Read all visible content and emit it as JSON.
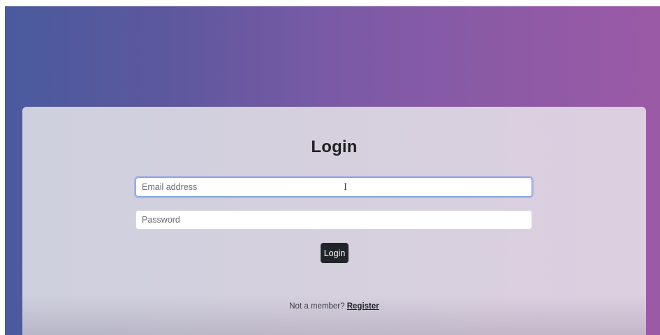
{
  "login_card": {
    "title": "Login",
    "email_placeholder": "Email address",
    "password_placeholder": "Password",
    "submit_label": "Login",
    "footer_prompt": "Not a member?",
    "register_link": "Register"
  },
  "colors": {
    "background_left": "#4a5a9e",
    "background_right": "#9b5aa6",
    "button": "#212529",
    "focus_ring": "#86a6e0"
  }
}
